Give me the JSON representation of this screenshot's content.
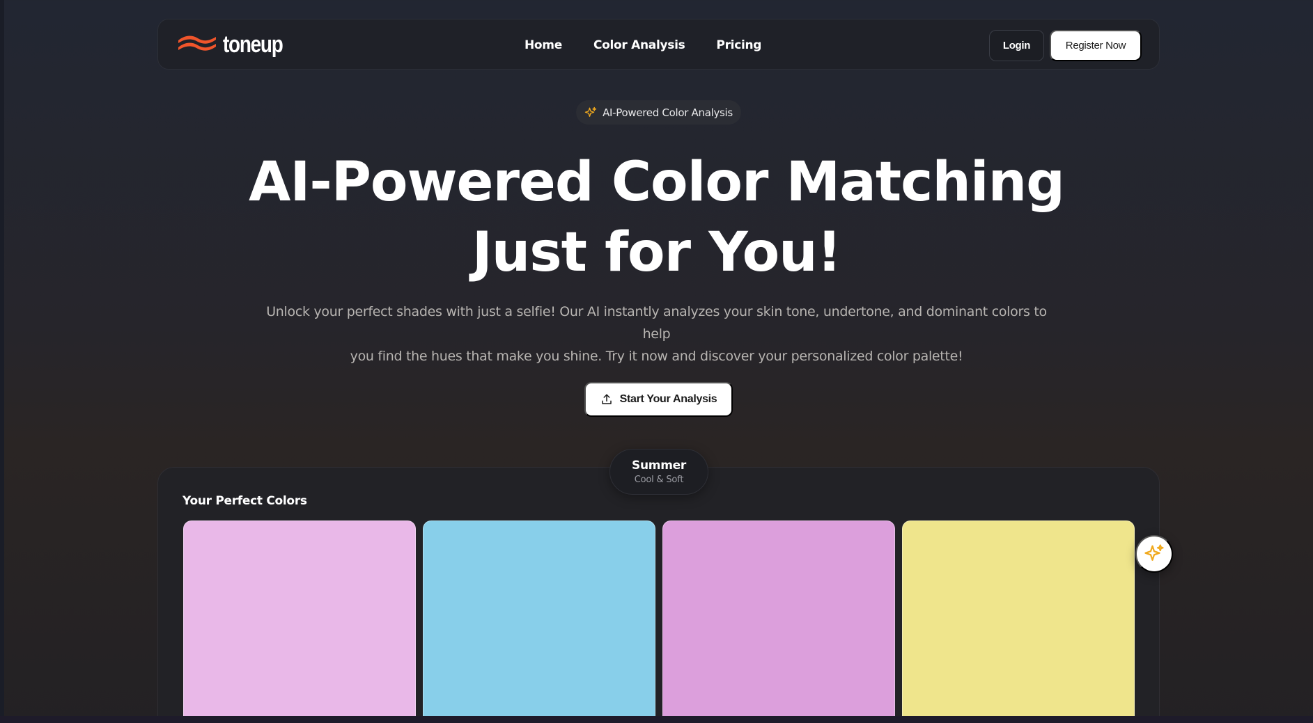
{
  "brand": {
    "name": "toneup",
    "accent_color": "#f0552b"
  },
  "nav": {
    "links": [
      {
        "label": "Home"
      },
      {
        "label": "Color Analysis"
      },
      {
        "label": "Pricing"
      }
    ],
    "login_label": "Login",
    "register_label": "Register Now"
  },
  "hero": {
    "badge_icon": "sparkle-icon",
    "badge_label": "AI-Powered Color Analysis",
    "title_line1": "AI-Powered Color Matching",
    "title_line2": "Just for You!",
    "description_line1": "Unlock your perfect shades with just a selfie! Our AI instantly analyzes your skin tone, undertone, and dominant colors to help",
    "description_line2": "you find the hues that make you shine. Try it now and discover your personalized color palette!",
    "cta_icon": "upload-icon",
    "cta_label": "Start Your Analysis"
  },
  "season": {
    "name": "Summer",
    "subtitle": "Cool & Soft"
  },
  "palette": {
    "title": "Your Perfect Colors",
    "swatches": [
      {
        "color": "#e9b8e8"
      },
      {
        "color": "#88cfea"
      },
      {
        "color": "#dc9fdc"
      },
      {
        "color": "#efe58c"
      }
    ]
  },
  "floating_button": {
    "icon": "sparkle-icon",
    "icon_color": "#f0a91e"
  }
}
